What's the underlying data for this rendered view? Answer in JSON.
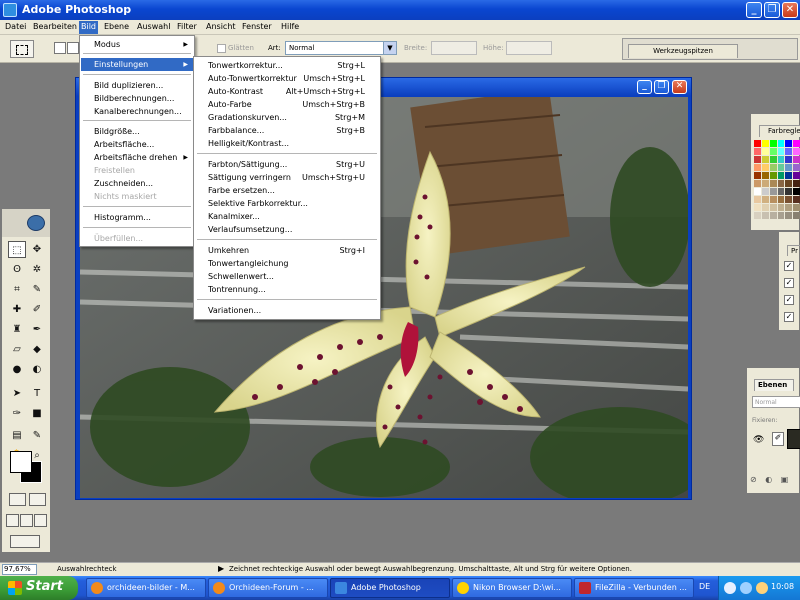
{
  "window": {
    "title": "Adobe Photoshop"
  },
  "menubar": [
    "Datei",
    "Bearbeiten",
    "Bild",
    "Ebene",
    "Auswahl",
    "Filter",
    "Ansicht",
    "Fenster",
    "Hilfe"
  ],
  "options": {
    "glaetten": "Glätten",
    "art_label": "Art:",
    "art_value": "Normal",
    "breite_label": "Breite:",
    "hoehe_label": "Höhe:",
    "palette_tab": "Werkzeugspitzen"
  },
  "bild_menu": [
    {
      "label": "Modus",
      "submenu": true
    },
    {
      "label": "Einstellungen",
      "submenu": true,
      "highlighted": true
    },
    {
      "label": "Bild duplizieren..."
    },
    {
      "label": "Bildberechnungen..."
    },
    {
      "label": "Kanalberechnungen..."
    },
    {
      "label": "Bildgröße..."
    },
    {
      "label": "Arbeitsfläche..."
    },
    {
      "label": "Arbeitsfläche drehen",
      "submenu": true
    },
    {
      "label": "Freistellen",
      "disabled": true
    },
    {
      "label": "Zuschneiden..."
    },
    {
      "label": "Nichts maskiert",
      "disabled": true
    },
    {
      "label": "Histogramm..."
    },
    {
      "label": "Überfüllen...",
      "disabled": true
    }
  ],
  "einstellungen_menu": [
    {
      "label": "Tonwertkorrektur...",
      "shortcut": "Strg+L"
    },
    {
      "label": "Auto-Tonwertkorrektur",
      "shortcut": "Umsch+Strg+L"
    },
    {
      "label": "Auto-Kontrast",
      "shortcut": "Alt+Umsch+Strg+L"
    },
    {
      "label": "Auto-Farbe",
      "shortcut": "Umsch+Strg+B"
    },
    {
      "label": "Gradationskurven...",
      "shortcut": "Strg+M"
    },
    {
      "label": "Farbbalance...",
      "shortcut": "Strg+B"
    },
    {
      "label": "Helligkeit/Kontrast...",
      "shortcut": ""
    },
    {
      "label": "Farbton/Sättigung...",
      "shortcut": "Strg+U"
    },
    {
      "label": "Sättigung verringern",
      "shortcut": "Umsch+Strg+U"
    },
    {
      "label": "Farbe ersetzen...",
      "shortcut": ""
    },
    {
      "label": "Selektive Farbkorrektur...",
      "shortcut": ""
    },
    {
      "label": "Kanalmixer...",
      "shortcut": ""
    },
    {
      "label": "Verlaufsumsetzung...",
      "shortcut": ""
    },
    {
      "label": "Umkehren",
      "shortcut": "Strg+I"
    },
    {
      "label": "Tonwertangleichung",
      "shortcut": ""
    },
    {
      "label": "Schwellenwert...",
      "shortcut": ""
    },
    {
      "label": "Tontrennung...",
      "shortcut": ""
    },
    {
      "label": "Variationen...",
      "shortcut": ""
    }
  ],
  "palettes": {
    "color_tab": "Farbregler",
    "protocol_tab": "Pr",
    "layers_tab": "Ebenen",
    "blend_mode": "Normal",
    "fixieren": "Fixieren:"
  },
  "status": {
    "zoom": "97,67%",
    "doc": "Auswahlrechteck",
    "hint": "Zeichnet rechteckige Auswahl oder bewegt Auswahlbegrenzung. Umschalttaste, Alt und Strg für weitere Optionen."
  },
  "taskbar": {
    "start": "Start",
    "tasks": [
      "orchideen-bilder - M...",
      "Orchideen-Forum - ...",
      "Adobe Photoshop",
      "Nikon Browser D:\\wi...",
      "FileZilla - Verbunden ..."
    ],
    "lang": "DE",
    "clock": "10:08"
  },
  "colors": {
    "accent": "#316ac5",
    "title_blue": "#0a46d0",
    "menu_bg": "#ece9d8"
  }
}
